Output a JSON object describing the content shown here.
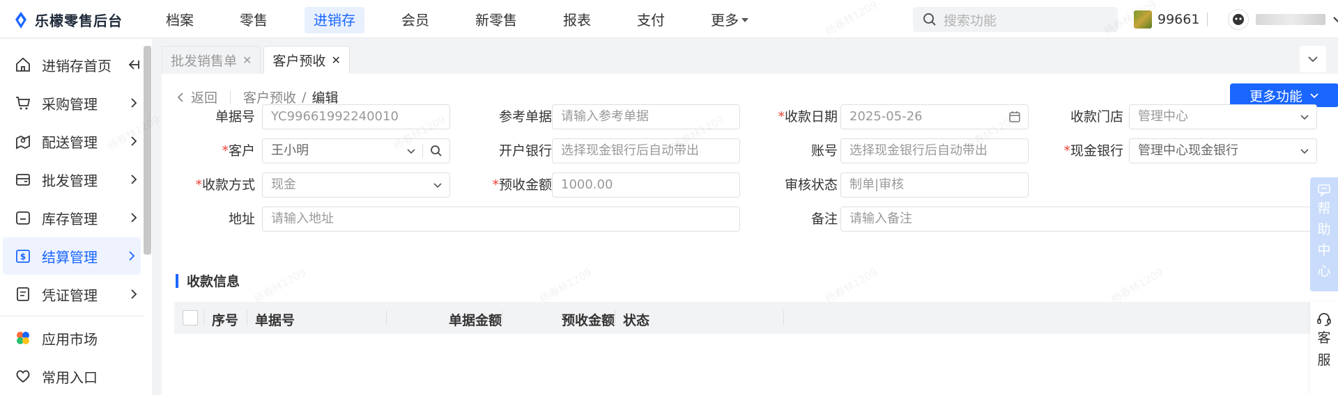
{
  "app": {
    "title": "乐檬零售后台"
  },
  "nav": {
    "items": [
      "档案",
      "零售",
      "进销存",
      "会员",
      "新零售",
      "报表",
      "支付",
      "更多"
    ]
  },
  "search": {
    "placeholder": "搜索功能"
  },
  "shop": {
    "id": "99661"
  },
  "sidebar": {
    "items": [
      {
        "label": "进销存首页"
      },
      {
        "label": "采购管理"
      },
      {
        "label": "配送管理"
      },
      {
        "label": "批发管理"
      },
      {
        "label": "库存管理"
      },
      {
        "label": "结算管理"
      },
      {
        "label": "凭证管理"
      },
      {
        "label": "应用市场"
      },
      {
        "label": "常用入口"
      }
    ]
  },
  "tabs": [
    {
      "label": "批发销售单"
    },
    {
      "label": "客户预收"
    }
  ],
  "breadcrumb": {
    "back": "返回",
    "parent": "客户预收",
    "sep": "/",
    "current": "编辑"
  },
  "more_button": {
    "label": "更多功能"
  },
  "form": {
    "doc_no": {
      "label": "单据号",
      "value": "YC99661992240010"
    },
    "ref_doc": {
      "label": "参考单据",
      "placeholder": "请输入参考单据"
    },
    "date": {
      "label": "收款日期",
      "value": "2025-05-26"
    },
    "store": {
      "label": "收款门店",
      "value": "管理中心"
    },
    "customer": {
      "label": "客户",
      "value": "王小明"
    },
    "bank": {
      "label": "开户银行",
      "placeholder": "选择现金银行后自动带出"
    },
    "account": {
      "label": "账号",
      "placeholder": "选择现金银行后自动带出"
    },
    "cash_bank": {
      "label": "现金银行",
      "value": "管理中心现金银行"
    },
    "pay_method": {
      "label": "收款方式",
      "value": "现金"
    },
    "amount": {
      "label": "预收金额",
      "value": "1000.00"
    },
    "audit": {
      "label": "审核状态",
      "value": "制单|审核"
    },
    "address": {
      "label": "地址",
      "placeholder": "请输入地址"
    },
    "remark": {
      "label": "备注",
      "placeholder": "请输入备注"
    }
  },
  "section": {
    "title": "收款信息"
  },
  "table": {
    "columns": [
      "序号",
      "单据号",
      "单据金额",
      "预收金额",
      "状态"
    ]
  },
  "help": {
    "chars": [
      "帮",
      "助",
      "中",
      "心"
    ]
  },
  "kefu": {
    "chars": [
      "客",
      "服"
    ]
  },
  "watermark": "杨春林1209",
  "colors": {
    "accent": "#1a66ff",
    "required": "#f04134"
  }
}
